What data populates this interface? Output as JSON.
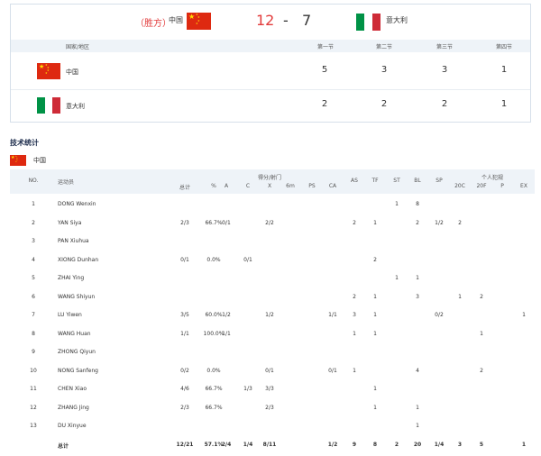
{
  "match": {
    "winner_label": "（胜方）",
    "home_name": "中国",
    "home_score": "12",
    "separator": "-",
    "away_score": "7",
    "away_name": "意大利",
    "colors": {
      "home_score": "#e23b3b",
      "china_red": "#de2910",
      "china_star": "#ffde00",
      "italy_green": "#009246",
      "italy_white": "#ffffff",
      "italy_red": "#ce2b37"
    }
  },
  "periods": {
    "headers": [
      "国家/地区",
      "第一节",
      "第二节",
      "第三节",
      "第四节"
    ],
    "rows": [
      {
        "team": "中国",
        "flag": "china-flag-icon",
        "q": [
          "5",
          "3",
          "3",
          "1"
        ]
      },
      {
        "team": "意大利",
        "flag": "italy-flag-icon",
        "q": [
          "2",
          "2",
          "2",
          "1"
        ]
      }
    ]
  },
  "stats": {
    "title": "技术统计",
    "team": "中国",
    "group_headers": {
      "scoring": "得分/射门",
      "fouls": "个人犯规"
    },
    "columns": [
      "NO.",
      "运动员",
      "总计",
      "%",
      "A",
      "C",
      "X",
      "6m",
      "PS",
      "CA",
      "AS",
      "TF",
      "ST",
      "BL",
      "SP",
      "20C",
      "20F",
      "P",
      "EX"
    ],
    "players": [
      {
        "no": "1",
        "name": "DONG Wenxin",
        "total": "",
        "pct": "",
        "A": "",
        "C": "",
        "X": "",
        "m6": "",
        "PS": "",
        "CA": "",
        "AS": "",
        "TF": "",
        "ST": "1",
        "BL": "8",
        "SP": "",
        "c20": "",
        "f20": "",
        "P": "",
        "EX": ""
      },
      {
        "no": "2",
        "name": "YAN Siya",
        "total": "2/3",
        "pct": "66.7%",
        "A": "0/1",
        "C": "",
        "X": "2/2",
        "m6": "",
        "PS": "",
        "CA": "",
        "AS": "2",
        "TF": "1",
        "ST": "",
        "BL": "2",
        "SP": "1/2",
        "c20": "2",
        "f20": "",
        "P": "",
        "EX": ""
      },
      {
        "no": "3",
        "name": "PAN Xiuhua",
        "total": "",
        "pct": "",
        "A": "",
        "C": "",
        "X": "",
        "m6": "",
        "PS": "",
        "CA": "",
        "AS": "",
        "TF": "",
        "ST": "",
        "BL": "",
        "SP": "",
        "c20": "",
        "f20": "",
        "P": "",
        "EX": ""
      },
      {
        "no": "4",
        "name": "XIONG Dunhan",
        "total": "0/1",
        "pct": "0.0%",
        "A": "",
        "C": "0/1",
        "X": "",
        "m6": "",
        "PS": "",
        "CA": "",
        "AS": "",
        "TF": "2",
        "ST": "",
        "BL": "",
        "SP": "",
        "c20": "",
        "f20": "",
        "P": "",
        "EX": ""
      },
      {
        "no": "5",
        "name": "ZHAI Ying",
        "total": "",
        "pct": "",
        "A": "",
        "C": "",
        "X": "",
        "m6": "",
        "PS": "",
        "CA": "",
        "AS": "",
        "TF": "",
        "ST": "1",
        "BL": "1",
        "SP": "",
        "c20": "",
        "f20": "",
        "P": "",
        "EX": ""
      },
      {
        "no": "6",
        "name": "WANG Shiyun",
        "total": "",
        "pct": "",
        "A": "",
        "C": "",
        "X": "",
        "m6": "",
        "PS": "",
        "CA": "",
        "AS": "2",
        "TF": "1",
        "ST": "",
        "BL": "3",
        "SP": "",
        "c20": "1",
        "f20": "2",
        "P": "",
        "EX": ""
      },
      {
        "no": "7",
        "name": "LU Yiwen",
        "total": "3/5",
        "pct": "60.0%",
        "A": "1/2",
        "C": "",
        "X": "1/2",
        "m6": "",
        "PS": "",
        "CA": "1/1",
        "AS": "3",
        "TF": "1",
        "ST": "",
        "BL": "",
        "SP": "0/2",
        "c20": "",
        "f20": "",
        "P": "",
        "EX": "1"
      },
      {
        "no": "8",
        "name": "WANG Huan",
        "total": "1/1",
        "pct": "100.0%",
        "A": "1/1",
        "C": "",
        "X": "",
        "m6": "",
        "PS": "",
        "CA": "",
        "AS": "1",
        "TF": "1",
        "ST": "",
        "BL": "",
        "SP": "",
        "c20": "",
        "f20": "1",
        "P": "",
        "EX": ""
      },
      {
        "no": "9",
        "name": "ZHONG Qiyun",
        "total": "",
        "pct": "",
        "A": "",
        "C": "",
        "X": "",
        "m6": "",
        "PS": "",
        "CA": "",
        "AS": "",
        "TF": "",
        "ST": "",
        "BL": "",
        "SP": "",
        "c20": "",
        "f20": "",
        "P": "",
        "EX": ""
      },
      {
        "no": "10",
        "name": "NONG Sanfeng",
        "total": "0/2",
        "pct": "0.0%",
        "A": "",
        "C": "",
        "X": "0/1",
        "m6": "",
        "PS": "",
        "CA": "0/1",
        "AS": "1",
        "TF": "",
        "ST": "",
        "BL": "4",
        "SP": "",
        "c20": "",
        "f20": "2",
        "P": "",
        "EX": ""
      },
      {
        "no": "11",
        "name": "CHEN Xiao",
        "total": "4/6",
        "pct": "66.7%",
        "A": "",
        "C": "1/3",
        "X": "3/3",
        "m6": "",
        "PS": "",
        "CA": "",
        "AS": "",
        "TF": "1",
        "ST": "",
        "BL": "",
        "SP": "",
        "c20": "",
        "f20": "",
        "P": "",
        "EX": ""
      },
      {
        "no": "12",
        "name": "ZHANG Jing",
        "total": "2/3",
        "pct": "66.7%",
        "A": "",
        "C": "",
        "X": "2/3",
        "m6": "",
        "PS": "",
        "CA": "",
        "AS": "",
        "TF": "1",
        "ST": "",
        "BL": "1",
        "SP": "",
        "c20": "",
        "f20": "",
        "P": "",
        "EX": ""
      },
      {
        "no": "13",
        "name": "DU Xinyue",
        "total": "",
        "pct": "",
        "A": "",
        "C": "",
        "X": "",
        "m6": "",
        "PS": "",
        "CA": "",
        "AS": "",
        "TF": "",
        "ST": "",
        "BL": "1",
        "SP": "",
        "c20": "",
        "f20": "",
        "P": "",
        "EX": ""
      }
    ],
    "totals": {
      "label": "总计",
      "total": "12/21",
      "pct": "57.1%",
      "A": "2/4",
      "C": "1/4",
      "X": "8/11",
      "m6": "",
      "PS": "",
      "CA": "1/2",
      "AS": "9",
      "TF": "8",
      "ST": "2",
      "BL": "20",
      "SP": "1/4",
      "c20": "3",
      "f20": "5",
      "P": "",
      "EX": "1"
    }
  }
}
